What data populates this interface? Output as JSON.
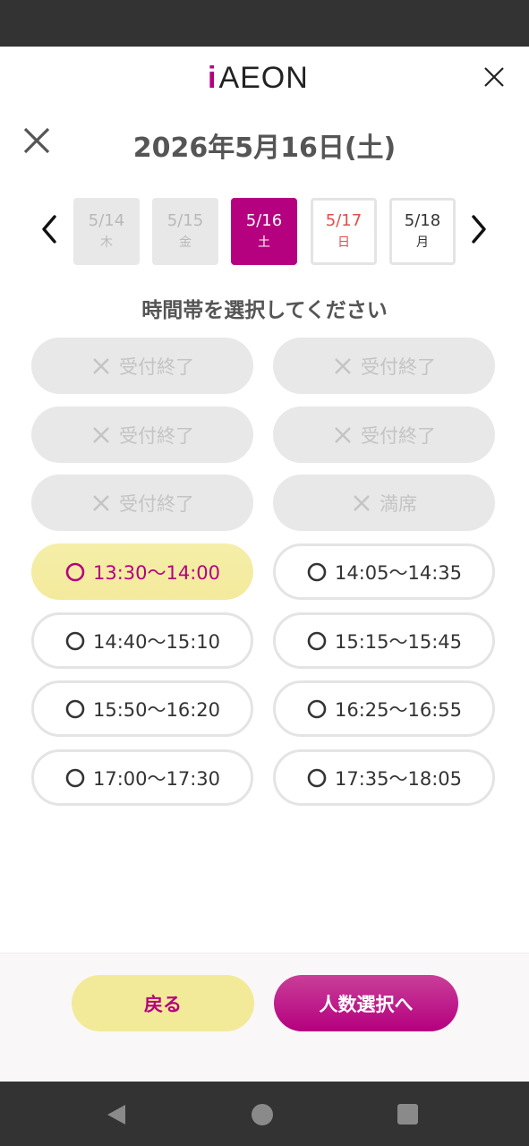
{
  "app": {
    "logo_i": "i",
    "logo_text": "AEON"
  },
  "header": {
    "date_title": "2026年5月16日(土)"
  },
  "dates": [
    {
      "date": "5/14",
      "weekday": "木",
      "state": "disabled"
    },
    {
      "date": "5/15",
      "weekday": "金",
      "state": "disabled"
    },
    {
      "date": "5/16",
      "weekday": "土",
      "state": "selected"
    },
    {
      "date": "5/17",
      "weekday": "日",
      "state": "sunday"
    },
    {
      "date": "5/18",
      "weekday": "月",
      "state": "normal"
    }
  ],
  "instruction": "時間帯を選択してください",
  "slots": [
    {
      "label": "受付終了",
      "state": "closed"
    },
    {
      "label": "受付終了",
      "state": "closed"
    },
    {
      "label": "受付終了",
      "state": "closed"
    },
    {
      "label": "受付終了",
      "state": "closed"
    },
    {
      "label": "受付終了",
      "state": "closed"
    },
    {
      "label": "満席",
      "state": "closed"
    },
    {
      "label": "13:30〜14:00",
      "state": "selected"
    },
    {
      "label": "14:05〜14:35",
      "state": "open"
    },
    {
      "label": "14:40〜15:10",
      "state": "open"
    },
    {
      "label": "15:15〜15:45",
      "state": "open"
    },
    {
      "label": "15:50〜16:20",
      "state": "open"
    },
    {
      "label": "16:25〜16:55",
      "state": "open"
    },
    {
      "label": "17:00〜17:30",
      "state": "open"
    },
    {
      "label": "17:35〜18:05",
      "state": "open"
    }
  ],
  "buttons": {
    "back": "戻る",
    "next": "人数選択へ"
  },
  "colors": {
    "brand": "#b5007f",
    "highlight": "#f3ea9c",
    "sunday": "#e24b4b",
    "disabled": "#e8e8e8"
  },
  "icons": {
    "close": "close-icon",
    "prev": "chevron-left-icon",
    "next": "chevron-right-icon",
    "slot_open": "circle-icon",
    "slot_closed": "x-icon"
  }
}
